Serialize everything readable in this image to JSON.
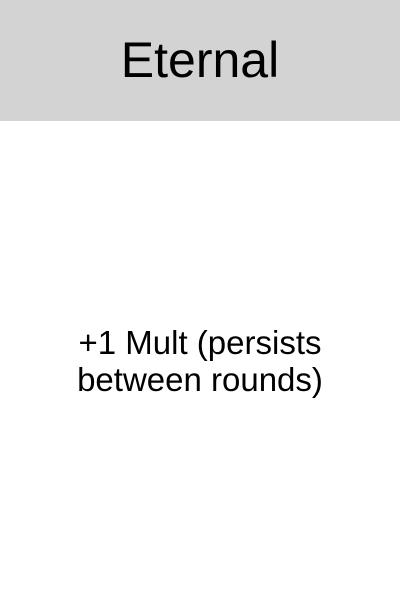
{
  "card": {
    "title": "Eternal",
    "description": "+1 Mult (persists between rounds)"
  },
  "colors": {
    "header_background": "#d3d3d3",
    "card_background": "#ffffff",
    "text": "#000000"
  }
}
